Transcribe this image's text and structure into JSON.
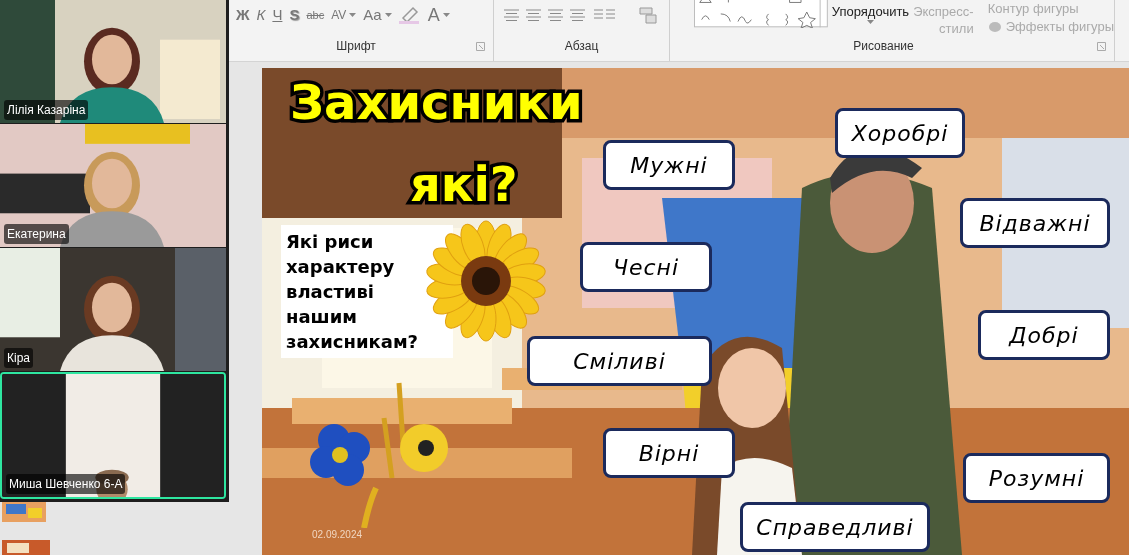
{
  "ribbon": {
    "font_group": {
      "label": "Шрифт",
      "buttons": [
        {
          "text": "Ж",
          "kind": "bold"
        },
        {
          "text": "К",
          "kind": "italic"
        },
        {
          "text": "Ч",
          "kind": "underline"
        },
        {
          "text": "S",
          "kind": "shadow"
        },
        {
          "text": "abc",
          "kind": "strike"
        },
        {
          "text": "AV",
          "kind": "spacing"
        },
        {
          "text": "Aa",
          "kind": "case"
        },
        {
          "text": "A",
          "kind": "color"
        }
      ]
    },
    "paragraph_group": {
      "label": "Абзац"
    },
    "drawing_group": {
      "label": "Рисование",
      "arrange": "Упорядочить",
      "quick_styles": [
        "Экспресс-",
        "стили"
      ],
      "shape_outline": "Контур фигуры",
      "shape_effects": "Эффекты фигуры"
    }
  },
  "participants": [
    {
      "name": "Лілія Казаріна",
      "selected": false
    },
    {
      "name": "Екатерина",
      "selected": false
    },
    {
      "name": "Кіра",
      "selected": false
    },
    {
      "name": "Миша Шевченко 6-А",
      "selected": true
    }
  ],
  "slide": {
    "title_lines": [
      "Захисники",
      "які?"
    ],
    "question_lines": [
      "Які риси",
      "характеру",
      "властиві",
      "нашим",
      "захисникам?"
    ],
    "traits": [
      {
        "text": "Мужні"
      },
      {
        "text": "Хоробрі"
      },
      {
        "text": "Відважні"
      },
      {
        "text": "Чесні"
      },
      {
        "text": "Добрі"
      },
      {
        "text": "Сміливі"
      },
      {
        "text": "Вірні"
      },
      {
        "text": "Розумні"
      },
      {
        "text": "Справедливі"
      }
    ],
    "date": "02.09.2024"
  }
}
